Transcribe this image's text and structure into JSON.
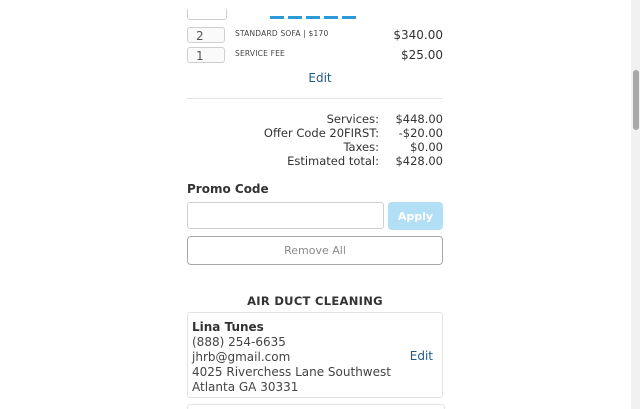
{
  "line_items": [
    {
      "qty": "2",
      "name": "STANDARD SOFA | $170",
      "price": "$340.00"
    },
    {
      "qty": "1",
      "name": "SERVICE FEE",
      "price": "$25.00"
    }
  ],
  "edit_label": "Edit",
  "totals": [
    {
      "label": "Services:",
      "value": "$448.00"
    },
    {
      "label": "Offer Code 20FIRST:",
      "value": "-$20.00"
    },
    {
      "label": "Taxes:",
      "value": "$0.00"
    },
    {
      "label": "Estimated total:",
      "value": "$428.00"
    }
  ],
  "promo": {
    "title": "Promo Code",
    "placeholder": "",
    "apply_label": "Apply",
    "apply_color": "#b2def6"
  },
  "remove_all_label": "Remove All",
  "section": {
    "title": "AIR DUCT CLEANING",
    "contact": {
      "name": "Lina Tunes",
      "phone": "(888) 254-6635",
      "email": "jhrb@gmail.com",
      "address1": "4025 Riverchess Lane Southwest",
      "address2": "Atlanta GA 30331",
      "edit_label": "Edit"
    }
  },
  "colors": {
    "accent": "#2a9bd8",
    "link": "#1f5a8a"
  }
}
